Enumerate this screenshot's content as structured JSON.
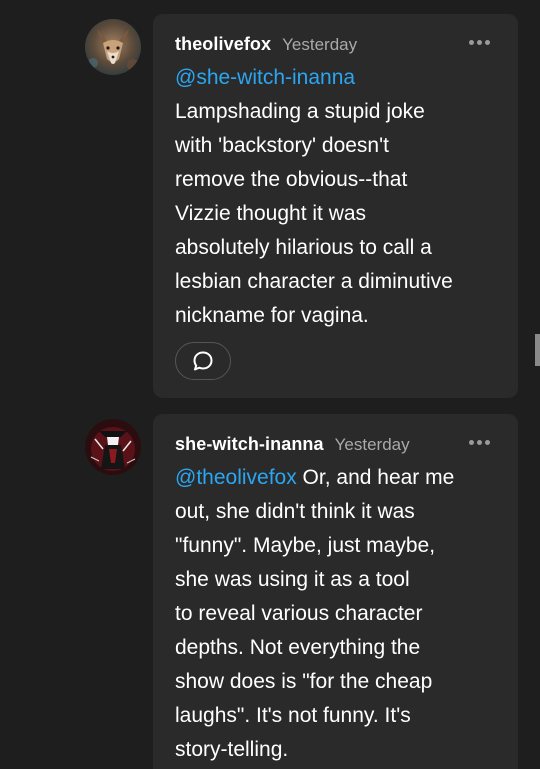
{
  "comments": [
    {
      "username": "theolivefox",
      "timestamp": "Yesterday",
      "mention": "@she-witch-inanna",
      "text_lines": [
        "Lampshading a stupid joke",
        "with 'backstory' doesn't",
        "remove the obvious--that",
        "Vizzie thought it was",
        "absolutely hilarious to call a",
        "lesbian character a diminutive",
        "nickname for vagina."
      ],
      "avatar_icon": "fox-avatar"
    },
    {
      "username": "she-witch-inanna",
      "timestamp": "Yesterday",
      "mention": "@theolivefox",
      "first_line_rest": " Or, and hear me",
      "text_lines": [
        "out, she didn't think it was",
        "\"funny\". Maybe, just maybe,",
        "she was using it as a tool",
        "to reveal various character",
        "depths. Not everything the",
        "show does is \"for the cheap",
        "laughs\". It's not funny. It's",
        "story-telling."
      ],
      "avatar_icon": "witch-avatar"
    }
  ],
  "colors": {
    "background": "#1e1e1e",
    "card": "#2a2a2a",
    "mention": "#2aa6f2",
    "timestamp": "#a9a9a9"
  },
  "icons": {
    "more": "more-horizontal-icon",
    "reply": "speech-bubble-icon"
  }
}
